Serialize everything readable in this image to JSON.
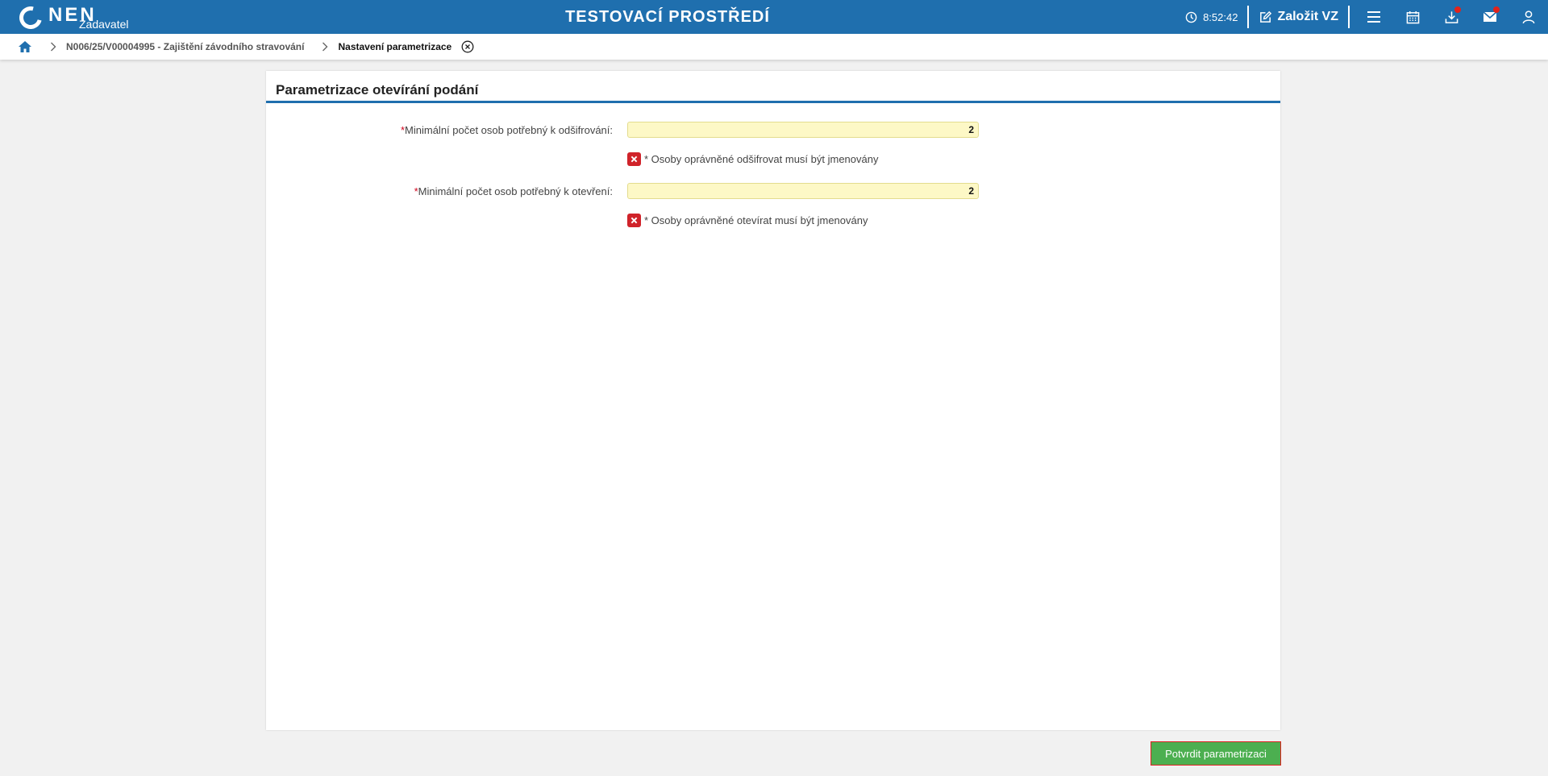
{
  "header": {
    "logo_text": "NEN",
    "logo_sub": "Zadavatel",
    "environment": "TESTOVACÍ PROSTŘEDÍ",
    "clock": "8:52:42",
    "create_label": "Založit VZ"
  },
  "breadcrumb": {
    "items": [
      "N006/25/V00004995 - Zajištění závodního stravování",
      "Nastavení parametrizace"
    ]
  },
  "panel": {
    "title": "Parametrizace otevírání podání",
    "fields": [
      {
        "label": "Minimální počet osob potřebný k odšifrování:",
        "value": "2",
        "required_mark": "*"
      },
      {
        "label": "Minimální počet osob potřebný k otevření:",
        "value": "2",
        "required_mark": "*"
      }
    ],
    "checks": [
      {
        "label": "* Osoby oprávněné odšifrovat musí být jmenovány",
        "checked": false
      },
      {
        "label": "* Osoby oprávněné otevírat musí být jmenovány",
        "checked": false
      }
    ]
  },
  "footer": {
    "confirm_label": "Potvrdit parametrizaci"
  },
  "colors": {
    "primary": "#1f6fae",
    "confirm": "#4caf50",
    "error": "#d0232a",
    "input_bg": "#fdf8c6"
  },
  "icons": [
    "home-icon",
    "chevron-right-icon",
    "close-circle-icon",
    "clock-icon",
    "edit-icon",
    "menu-icon",
    "calendar-icon",
    "download-icon",
    "mail-icon",
    "user-icon",
    "x-box-icon"
  ]
}
